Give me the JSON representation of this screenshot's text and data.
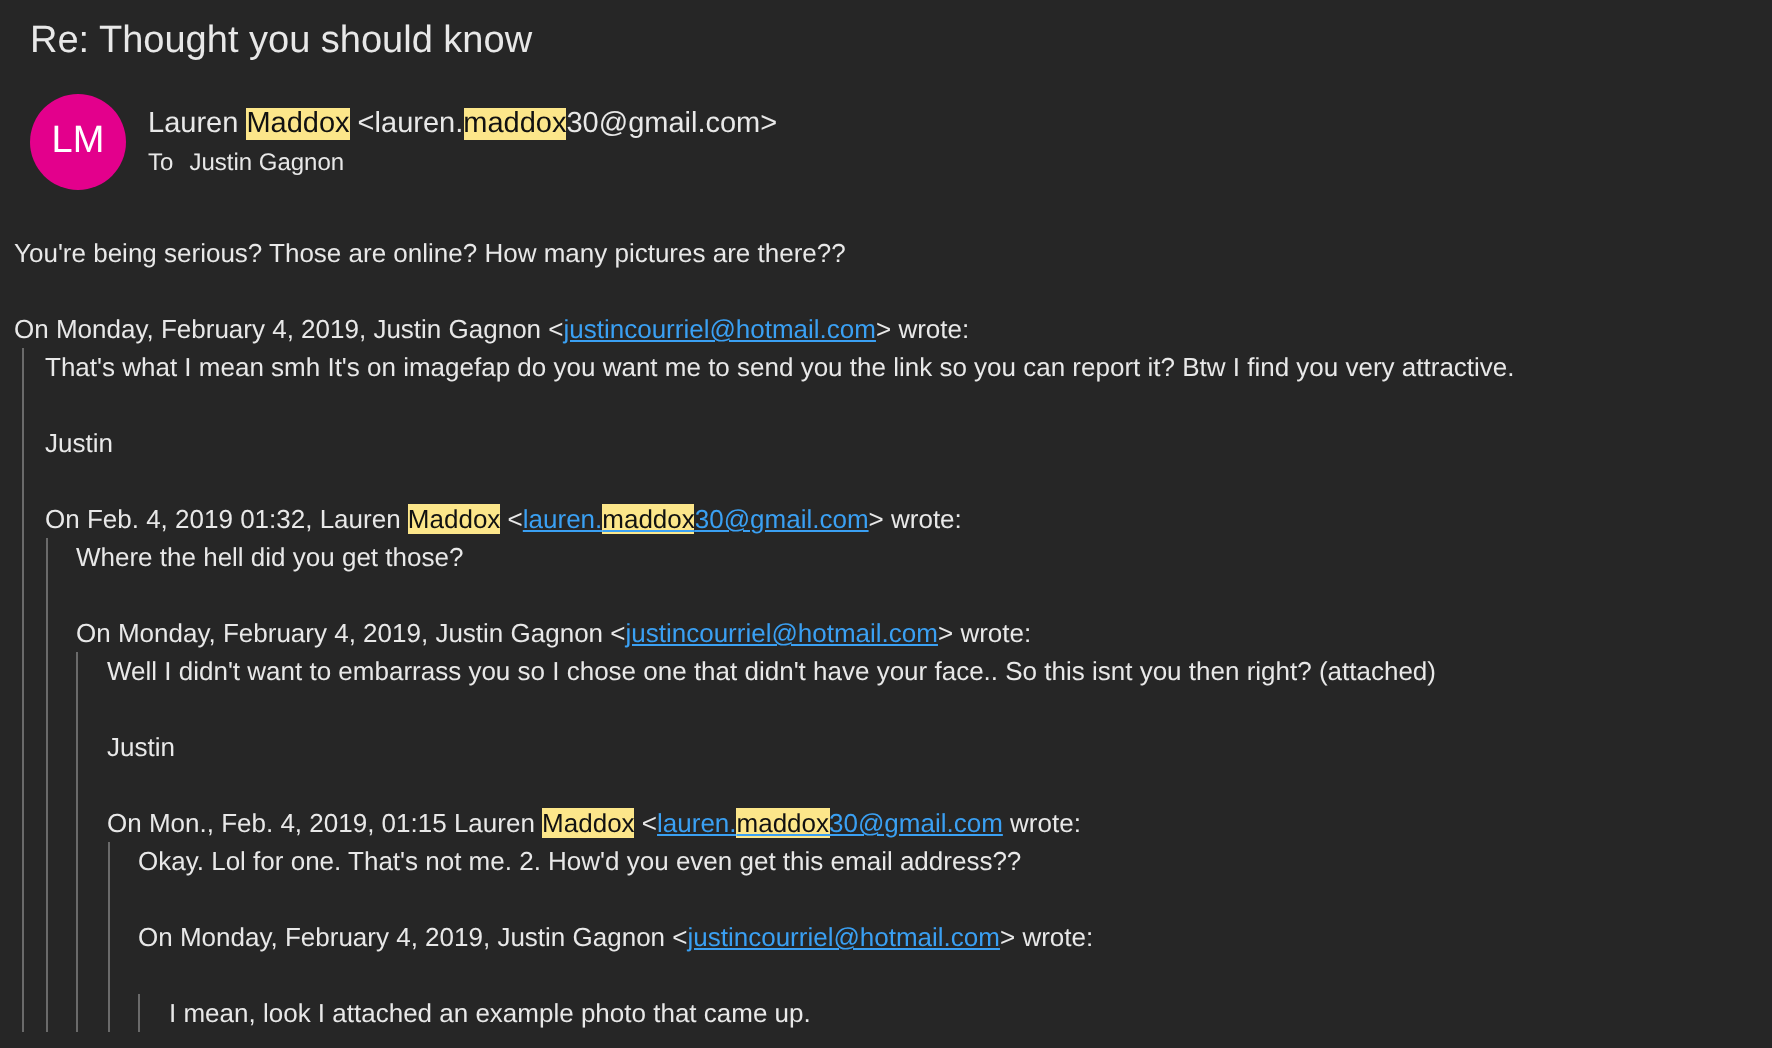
{
  "subject": "Re: Thought you should know",
  "header": {
    "avatar_initials": "LM",
    "sender": [
      {
        "text": "Lauren ",
        "highlight": false
      },
      {
        "text": "Maddox",
        "highlight": true
      },
      {
        "text": " <lauren.",
        "highlight": false
      },
      {
        "text": "maddox",
        "highlight": true
      },
      {
        "text": "30@gmail.com>",
        "highlight": false
      }
    ],
    "to_label": "To",
    "to": "Justin Gagnon"
  },
  "body": {
    "lines": [
      "You're being serious? Those are online? How many pictures are there??"
    ],
    "quote": {
      "attribution": [
        {
          "kind": "text",
          "parts": [
            {
              "text": "On Monday, February 4, 2019, Justin Gagnon <",
              "highlight": false
            }
          ]
        },
        {
          "kind": "link",
          "parts": [
            {
              "text": "justincourriel@hotmail.com",
              "highlight": false
            }
          ]
        },
        {
          "kind": "text",
          "parts": [
            {
              "text": "> wrote:",
              "highlight": false
            }
          ]
        }
      ],
      "gap_before": false,
      "lines": [
        "That's what I mean smh It's on imagefap do you want me to send you the link so you can report it? Btw I find you very attractive.",
        "Justin"
      ],
      "quote": {
        "attribution": [
          {
            "kind": "text",
            "parts": [
              {
                "text": "On Feb. 4, 2019 01:32, Lauren ",
                "highlight": false
              },
              {
                "text": "Maddox",
                "highlight": true
              },
              {
                "text": " <",
                "highlight": false
              }
            ]
          },
          {
            "kind": "link",
            "parts": [
              {
                "text": "lauren.",
                "highlight": false
              },
              {
                "text": "maddox",
                "highlight": true
              },
              {
                "text": "30@gmail.com",
                "highlight": false
              }
            ]
          },
          {
            "kind": "text",
            "parts": [
              {
                "text": "> wrote:",
                "highlight": false
              }
            ]
          }
        ],
        "gap_before": false,
        "lines": [
          "Where the hell did you get those?"
        ],
        "quote": {
          "attribution": [
            {
              "kind": "text",
              "parts": [
                {
                  "text": "On Monday, February 4, 2019, Justin Gagnon <",
                  "highlight": false
                }
              ]
            },
            {
              "kind": "link",
              "parts": [
                {
                  "text": "justincourriel@hotmail.com",
                  "highlight": false
                }
              ]
            },
            {
              "kind": "text",
              "parts": [
                {
                  "text": "> wrote:",
                  "highlight": false
                }
              ]
            }
          ],
          "gap_before": false,
          "lines": [
            "Well I didn't want to embarrass you so I chose one that didn't have your face.. So this isnt you then right? (attached)",
            "Justin"
          ],
          "quote": {
            "attribution": [
              {
                "kind": "text",
                "parts": [
                  {
                    "text": "On Mon., Feb. 4, 2019, 01:15 Lauren ",
                    "highlight": false
                  },
                  {
                    "text": "Maddox",
                    "highlight": true
                  },
                  {
                    "text": " <",
                    "highlight": false
                  }
                ]
              },
              {
                "kind": "link",
                "parts": [
                  {
                    "text": "lauren.",
                    "highlight": false
                  },
                  {
                    "text": "maddox",
                    "highlight": true
                  },
                  {
                    "text": "30@gmail.com",
                    "highlight": false
                  }
                ]
              },
              {
                "kind": "text",
                "parts": [
                  {
                    "text": " wrote:",
                    "highlight": false
                  }
                ]
              }
            ],
            "gap_before": false,
            "lines": [
              "Okay. Lol for one. That's not me. 2. How'd you even get this email address??"
            ],
            "quote": {
              "attribution": [
                {
                  "kind": "text",
                  "parts": [
                    {
                      "text": "On Monday, February 4, 2019, Justin Gagnon <",
                      "highlight": false
                    }
                  ]
                },
                {
                  "kind": "link",
                  "parts": [
                    {
                      "text": "justincourriel@hotmail.com",
                      "highlight": false
                    }
                  ]
                },
                {
                  "kind": "text",
                  "parts": [
                    {
                      "text": "> wrote:",
                      "highlight": false
                    }
                  ]
                }
              ],
              "gap_before": true,
              "lines": [
                "I mean, look I attached an example photo that came up."
              ]
            }
          }
        }
      }
    }
  }
}
